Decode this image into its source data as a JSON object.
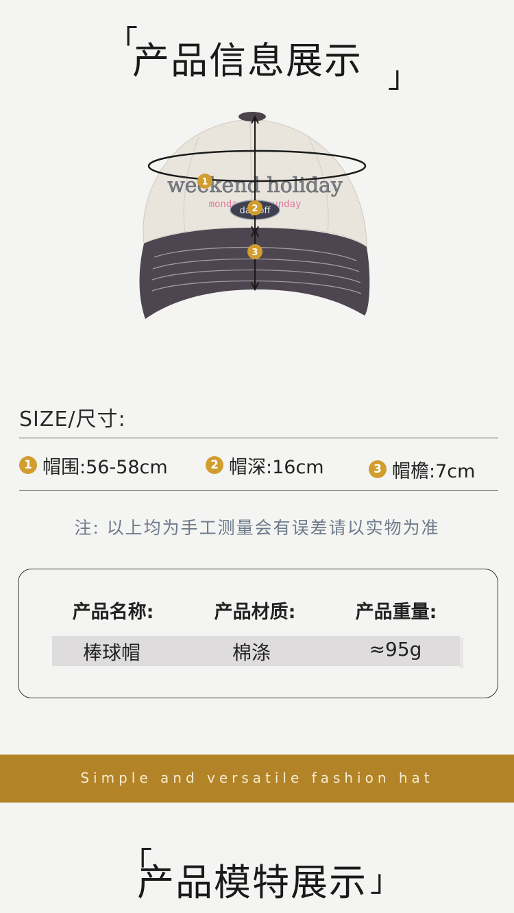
{
  "header": {
    "title": "产品信息展示",
    "bracket_open": "「",
    "bracket_close": "」"
  },
  "hat_image": {
    "embroidery_line1": "weekend holiday",
    "embroidery_line2": "monday to sunday",
    "patch_text": "day off",
    "markers": [
      "1",
      "2",
      "3"
    ]
  },
  "size": {
    "label": "SIZE/尺寸:",
    "items": [
      {
        "num": "1",
        "text": "帽围:56-58cm"
      },
      {
        "num": "2",
        "text": "帽深:16cm"
      },
      {
        "num": "3",
        "text": "帽檐:7cm"
      }
    ]
  },
  "note": "注: 以上均为手工测量会有误差请以实物为准",
  "product_table": {
    "headers": [
      "产品名称:",
      "产品材质:",
      "产品重量:"
    ],
    "values": [
      "棒球帽",
      "棉涤",
      "≈95g"
    ]
  },
  "banner": {
    "text": "Simple and versatile fashion hat"
  },
  "footer": {
    "title": "产品模特展示",
    "bracket_open": "「",
    "bracket_close": "」"
  },
  "colors": {
    "accent": "#d19d2e",
    "band": "#b38427",
    "background": "#f4f4f2"
  }
}
